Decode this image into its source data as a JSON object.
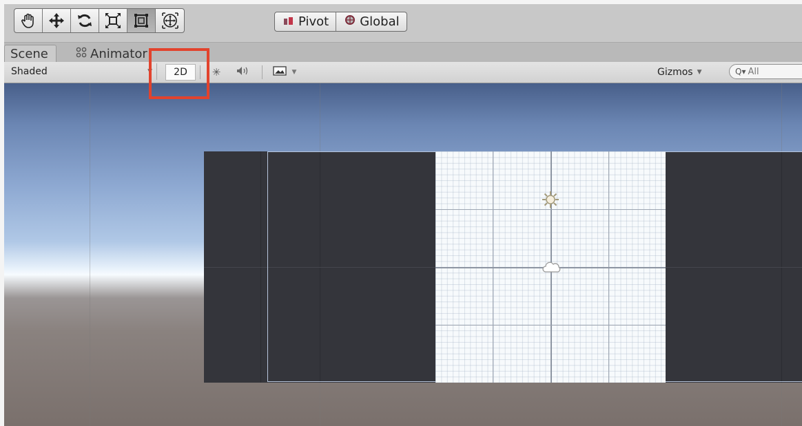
{
  "toolbar": {
    "tools": [
      {
        "name": "hand-tool",
        "icon": "hand-icon"
      },
      {
        "name": "move-tool",
        "icon": "move-arrows-icon"
      },
      {
        "name": "rotate-tool",
        "icon": "rotate-icon"
      },
      {
        "name": "scale-tool",
        "icon": "scale-icon"
      },
      {
        "name": "rect-tool",
        "icon": "rect-transform-icon",
        "active": true
      },
      {
        "name": "transform-tool",
        "icon": "transform-icon"
      }
    ],
    "pivot_label": "Pivot",
    "global_label": "Global"
  },
  "tabs": {
    "scene_label": "Scene",
    "animator_label": "Animator"
  },
  "scene_bar": {
    "shading_mode": "Shaded",
    "mode_2d_label": "2D",
    "gizmos_label": "Gizmos",
    "search_placeholder": "All"
  },
  "colors": {
    "highlight": "#e2432d",
    "canvas_dark": "#34353b",
    "sky_top": "#485f8a"
  }
}
